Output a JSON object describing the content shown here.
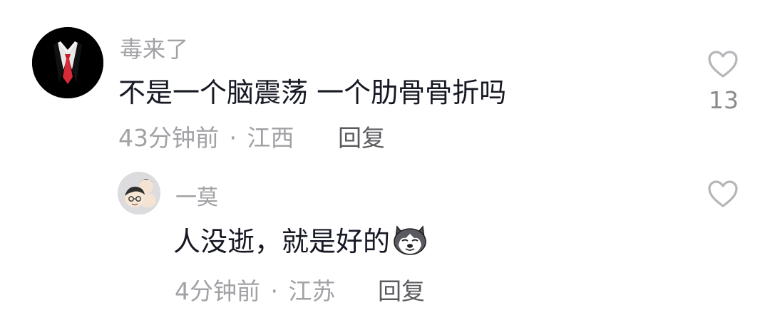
{
  "comments": [
    {
      "username": "毒来了",
      "text": "不是一个脑震荡 一个肋骨骨折吗",
      "time": "43分钟前",
      "separator": "·",
      "location": "江西",
      "reply_label": "回复",
      "like_count": "13",
      "avatar": "suit-and-tie-avatar"
    },
    {
      "username": "一莫",
      "text": "人没逝，就是好的",
      "emoji": "husky-dog-emoji",
      "time": "4分钟前",
      "separator": "·",
      "location": "江苏",
      "reply_label": "回复",
      "like_count": "",
      "avatar": "cartoon-face-avatar"
    }
  ],
  "colors": {
    "primary_text": "#161823",
    "secondary_text": "#a1a1a6",
    "reply_text": "#5a5a5f",
    "like_icon": "#b5b5ba"
  }
}
